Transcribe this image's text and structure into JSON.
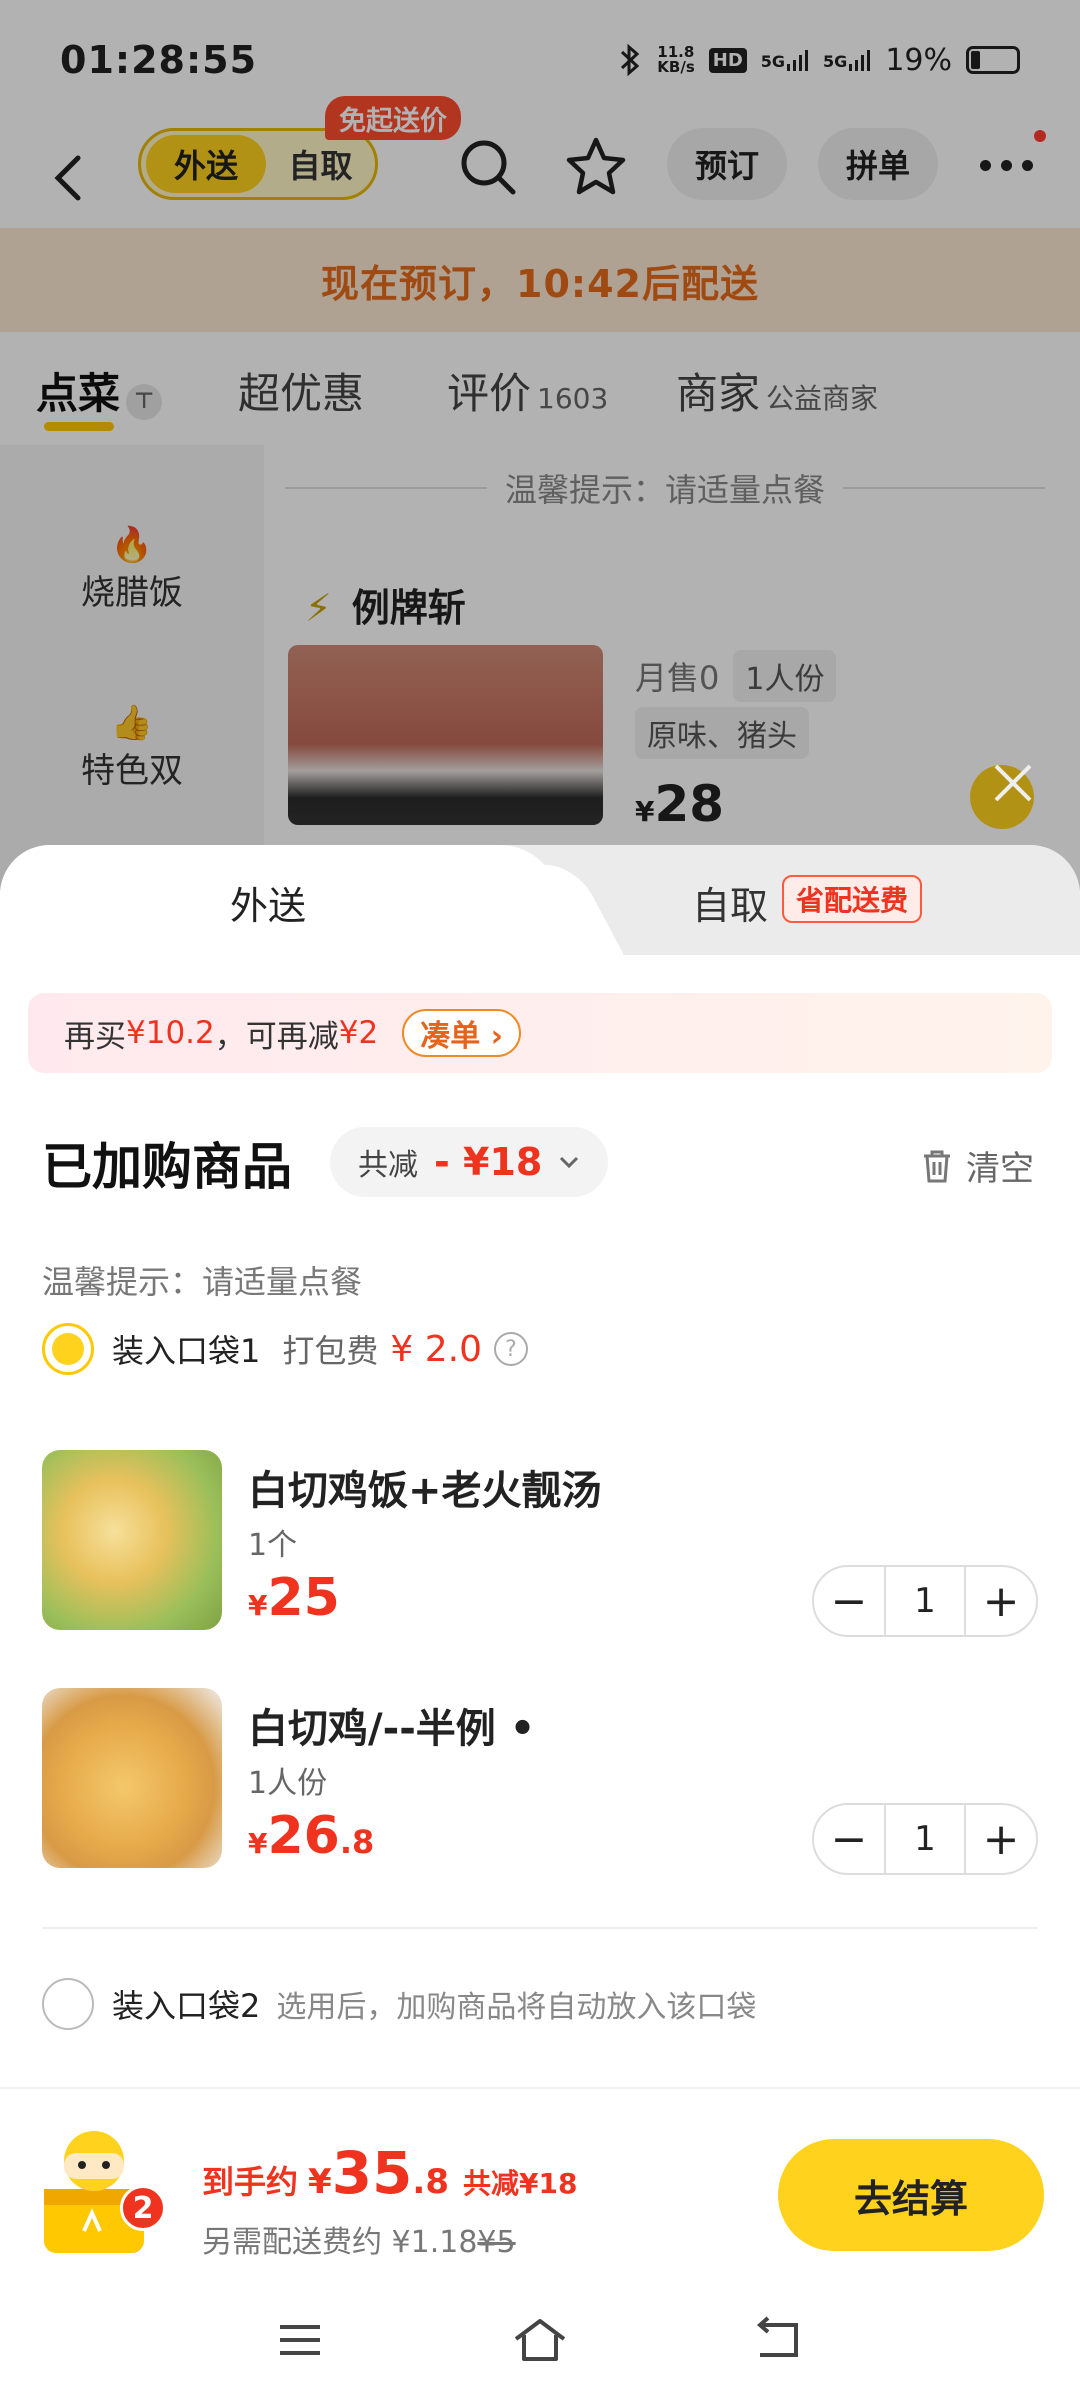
{
  "status": {
    "time": "01:28:55",
    "net_speed_top": "11.8",
    "net_speed_bottom": "KB/s",
    "hd": "HD",
    "sim1": "5G",
    "sim2": "5G",
    "battery": "19%"
  },
  "nav": {
    "mode_active": "外送",
    "mode_inactive": "自取",
    "free_delivery_badge": "免起送价",
    "reserve": "预订",
    "group": "拼单"
  },
  "banner": {
    "text": "现在预订，10:42后配送"
  },
  "tabs": [
    {
      "label": "点菜",
      "extra": ""
    },
    {
      "label": "超优惠",
      "extra": ""
    },
    {
      "label": "评价",
      "extra": "1603"
    },
    {
      "label": "商家",
      "extra": "公益商家"
    }
  ],
  "sidebar": {
    "items": [
      {
        "emoji": "🔥",
        "label": "烧腊饭"
      },
      {
        "emoji": "👍",
        "label": "特色双"
      }
    ]
  },
  "menu": {
    "tip": "温馨提示：请适量点餐",
    "category_icon": "⚡",
    "category": "例牌斩",
    "dish": {
      "sold": "月售0",
      "portion": "1人份",
      "flavor": "原味、猪头",
      "currency": "¥",
      "price": "28"
    }
  },
  "sheet": {
    "tab_delivery": "外送",
    "tab_pickup": "自取",
    "pickup_badge": "省配送费",
    "promo": {
      "part1": "再买",
      "amount1": "¥10.2",
      "part2": "，可再减",
      "amount2": "¥2",
      "button": "凑单 ›"
    },
    "title": "已加购商品",
    "discount_label": "共减",
    "discount_amount": "- ¥18",
    "clear": "清空",
    "tip": "温馨提示：请适量点餐",
    "bag1": {
      "label": "装入口袋1",
      "fee_label": "打包费",
      "fee": "¥ 2.0"
    },
    "items": [
      {
        "name": "白切鸡饭+老火靓汤",
        "sub": "1个",
        "currency": "¥",
        "price": "25",
        "decimal": "",
        "qty": "1"
      },
      {
        "name": "白切鸡/--半例 •",
        "sub": "1人份",
        "currency": "¥",
        "price": "26",
        "decimal": ".8",
        "qty": "1"
      }
    ],
    "bag2": {
      "label": "装入口袋2",
      "hint": "选用后，加购商品将自动放入该口袋"
    }
  },
  "checkout": {
    "count": "2",
    "label": "到手约",
    "currency": "¥",
    "total_int": "35",
    "total_dec": ".8",
    "saved": "共减¥18",
    "delivery_prefix": "另需配送费约 ¥1.18",
    "delivery_original": "¥5",
    "button": "去结算"
  },
  "colors": {
    "accent": "#ffd21e",
    "price_red": "#f0331e",
    "banner_orange": "#e56a1c"
  }
}
